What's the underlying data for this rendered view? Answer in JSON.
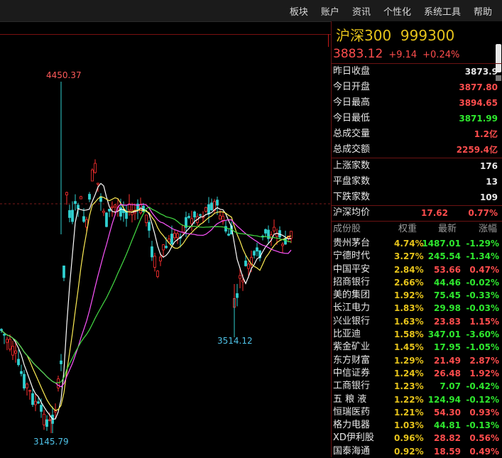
{
  "menu": [
    "板块",
    "账户",
    "资讯",
    "个性化",
    "系统工具",
    "帮助"
  ],
  "chart": {
    "high_label": "4450.37",
    "low_label": "3145.79",
    "mid_low_label": "3514.12",
    "colors": {
      "price_up": "#ff3030",
      "price_down": "#30d0d0",
      "ma5": "#ffffff",
      "ma10": "#ffee55",
      "ma20": "#ff55ff",
      "ma30": "#44dd44"
    }
  },
  "panel": {
    "title": "沪深300",
    "code": "999300",
    "price": "3883.12",
    "change": "+9.14",
    "change_pct": "+0.24%",
    "stats": [
      {
        "label": "昨日收盘",
        "value": "3873.9",
        "color": "#e8e8e8"
      },
      {
        "label": "今日开盘",
        "value": "3877.80",
        "color": "#ff4d4d"
      },
      {
        "label": "今日最高",
        "value": "3894.65",
        "color": "#ff4d4d"
      },
      {
        "label": "今日最低",
        "value": "3871.99",
        "color": "#2ee82e"
      },
      {
        "label": "总成交量",
        "value": "1.2亿",
        "color": "#ff4d4d"
      },
      {
        "label": "总成交额",
        "value": "2259.4亿",
        "color": "#ff4d4d"
      }
    ],
    "breadth": [
      {
        "label": "上涨家数",
        "value": "176"
      },
      {
        "label": "平盘家数",
        "value": "13"
      },
      {
        "label": "下跌家数",
        "value": "109"
      }
    ],
    "avg": {
      "label": "沪深均价",
      "price": "17.62",
      "pct": "0.77%"
    },
    "columns": {
      "name": "成份股",
      "weight": "权重",
      "latest": "最新",
      "change": "涨幅"
    },
    "constituents": [
      {
        "name": "贵州茅台",
        "weight": "4.74%",
        "price": "1487.01",
        "pct": "-1.29%",
        "dir": "down"
      },
      {
        "name": "宁德时代",
        "weight": "3.27%",
        "price": "245.54",
        "pct": "-1.34%",
        "dir": "down"
      },
      {
        "name": "中国平安",
        "weight": "2.84%",
        "price": "53.66",
        "pct": "0.47%",
        "dir": "up"
      },
      {
        "name": "招商银行",
        "weight": "2.66%",
        "price": "44.46",
        "pct": "-0.02%",
        "dir": "down"
      },
      {
        "name": "美的集团",
        "weight": "1.92%",
        "price": "75.45",
        "pct": "-0.33%",
        "dir": "down"
      },
      {
        "name": "长江电力",
        "weight": "1.83%",
        "price": "29.98",
        "pct": "-0.03%",
        "dir": "down"
      },
      {
        "name": "兴业银行",
        "weight": "1.63%",
        "price": "23.83",
        "pct": "1.15%",
        "dir": "up"
      },
      {
        "name": "比亚迪",
        "weight": "1.58%",
        "price": "347.01",
        "pct": "-3.60%",
        "dir": "down"
      },
      {
        "name": "紫金矿业",
        "weight": "1.45%",
        "price": "17.95",
        "pct": "-1.05%",
        "dir": "down"
      },
      {
        "name": "东方财富",
        "weight": "1.29%",
        "price": "21.49",
        "pct": "2.87%",
        "dir": "up"
      },
      {
        "name": "中信证券",
        "weight": "1.24%",
        "price": "26.48",
        "pct": "1.92%",
        "dir": "up"
      },
      {
        "name": "工商银行",
        "weight": "1.23%",
        "price": "7.07",
        "pct": "-0.42%",
        "dir": "down"
      },
      {
        "name": "五 粮 液",
        "weight": "1.22%",
        "price": "124.94",
        "pct": "-0.12%",
        "dir": "down"
      },
      {
        "name": "恒瑞医药",
        "weight": "1.21%",
        "price": "54.30",
        "pct": "0.93%",
        "dir": "up"
      },
      {
        "name": "格力电器",
        "weight": "1.03%",
        "price": "44.81",
        "pct": "-0.13%",
        "dir": "down"
      },
      {
        "name": "XD伊利股",
        "weight": "0.96%",
        "price": "28.82",
        "pct": "0.56%",
        "dir": "up"
      },
      {
        "name": "国泰海通",
        "weight": "0.92%",
        "price": "18.59",
        "pct": "0.49%",
        "dir": "up"
      }
    ]
  }
}
